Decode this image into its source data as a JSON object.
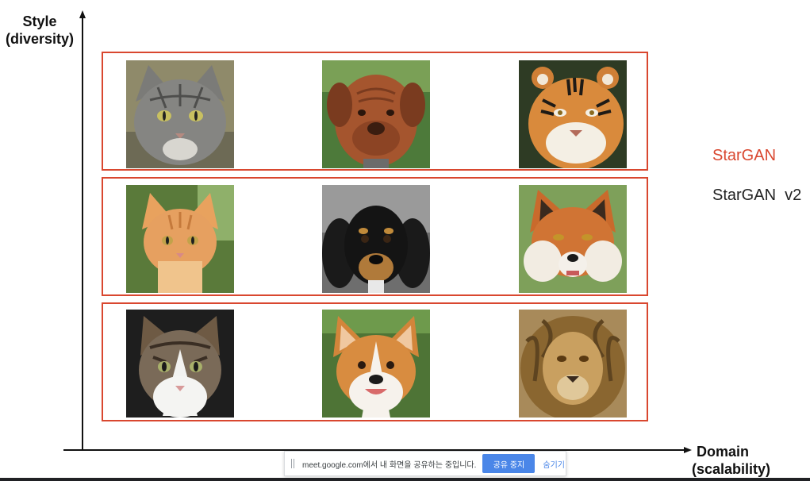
{
  "axes": {
    "y_label_line1": "Style",
    "y_label_line2": "(diversity)",
    "x_label_line1": "Domain",
    "x_label_line2": "(scalability)"
  },
  "legend": {
    "stargan": "StarGAN",
    "stargan_v2": "StarGAN  v2",
    "stargan_color": "#d9472f",
    "stargan_v2_color": "#222222"
  },
  "grid": {
    "box_color": "#d9472f",
    "rows": [
      [
        "tabby-cat",
        "mastiff-dog",
        "tiger"
      ],
      [
        "orange-kitten",
        "dachshund-dog",
        "red-fox"
      ],
      [
        "tabby-white-cat",
        "corgi-dog",
        "lion"
      ]
    ]
  },
  "share_bar": {
    "message": "meet.google.com에서 내 화면을 공유하는 중입니다.",
    "stop_label": "공유 중지",
    "hide_label": "숨기기",
    "button_color": "#4a86e8"
  }
}
